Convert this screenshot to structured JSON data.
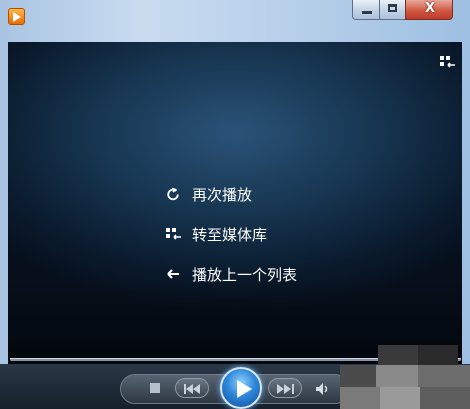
{
  "window": {
    "app_icon": "media-player-icon",
    "controls": {
      "minimize": "minimize-icon",
      "maximize": "maximize-icon",
      "close_glyph": "X"
    }
  },
  "video": {
    "mode_icon": "switch-to-library-icon",
    "menu": [
      {
        "label": "再次播放",
        "icon": "replay-icon"
      },
      {
        "label": "转至媒体库",
        "icon": "library-icon"
      },
      {
        "label": "播放上一个列表",
        "icon": "back-arrow-icon"
      }
    ]
  },
  "controls": {
    "stop": "stop-icon",
    "previous": "previous-icon",
    "play": "play-icon",
    "next": "next-icon",
    "volume": "volume-icon"
  },
  "colors": {
    "accent": "#2f87d9",
    "close": "#c0392b",
    "background": "#0a1a2c"
  }
}
